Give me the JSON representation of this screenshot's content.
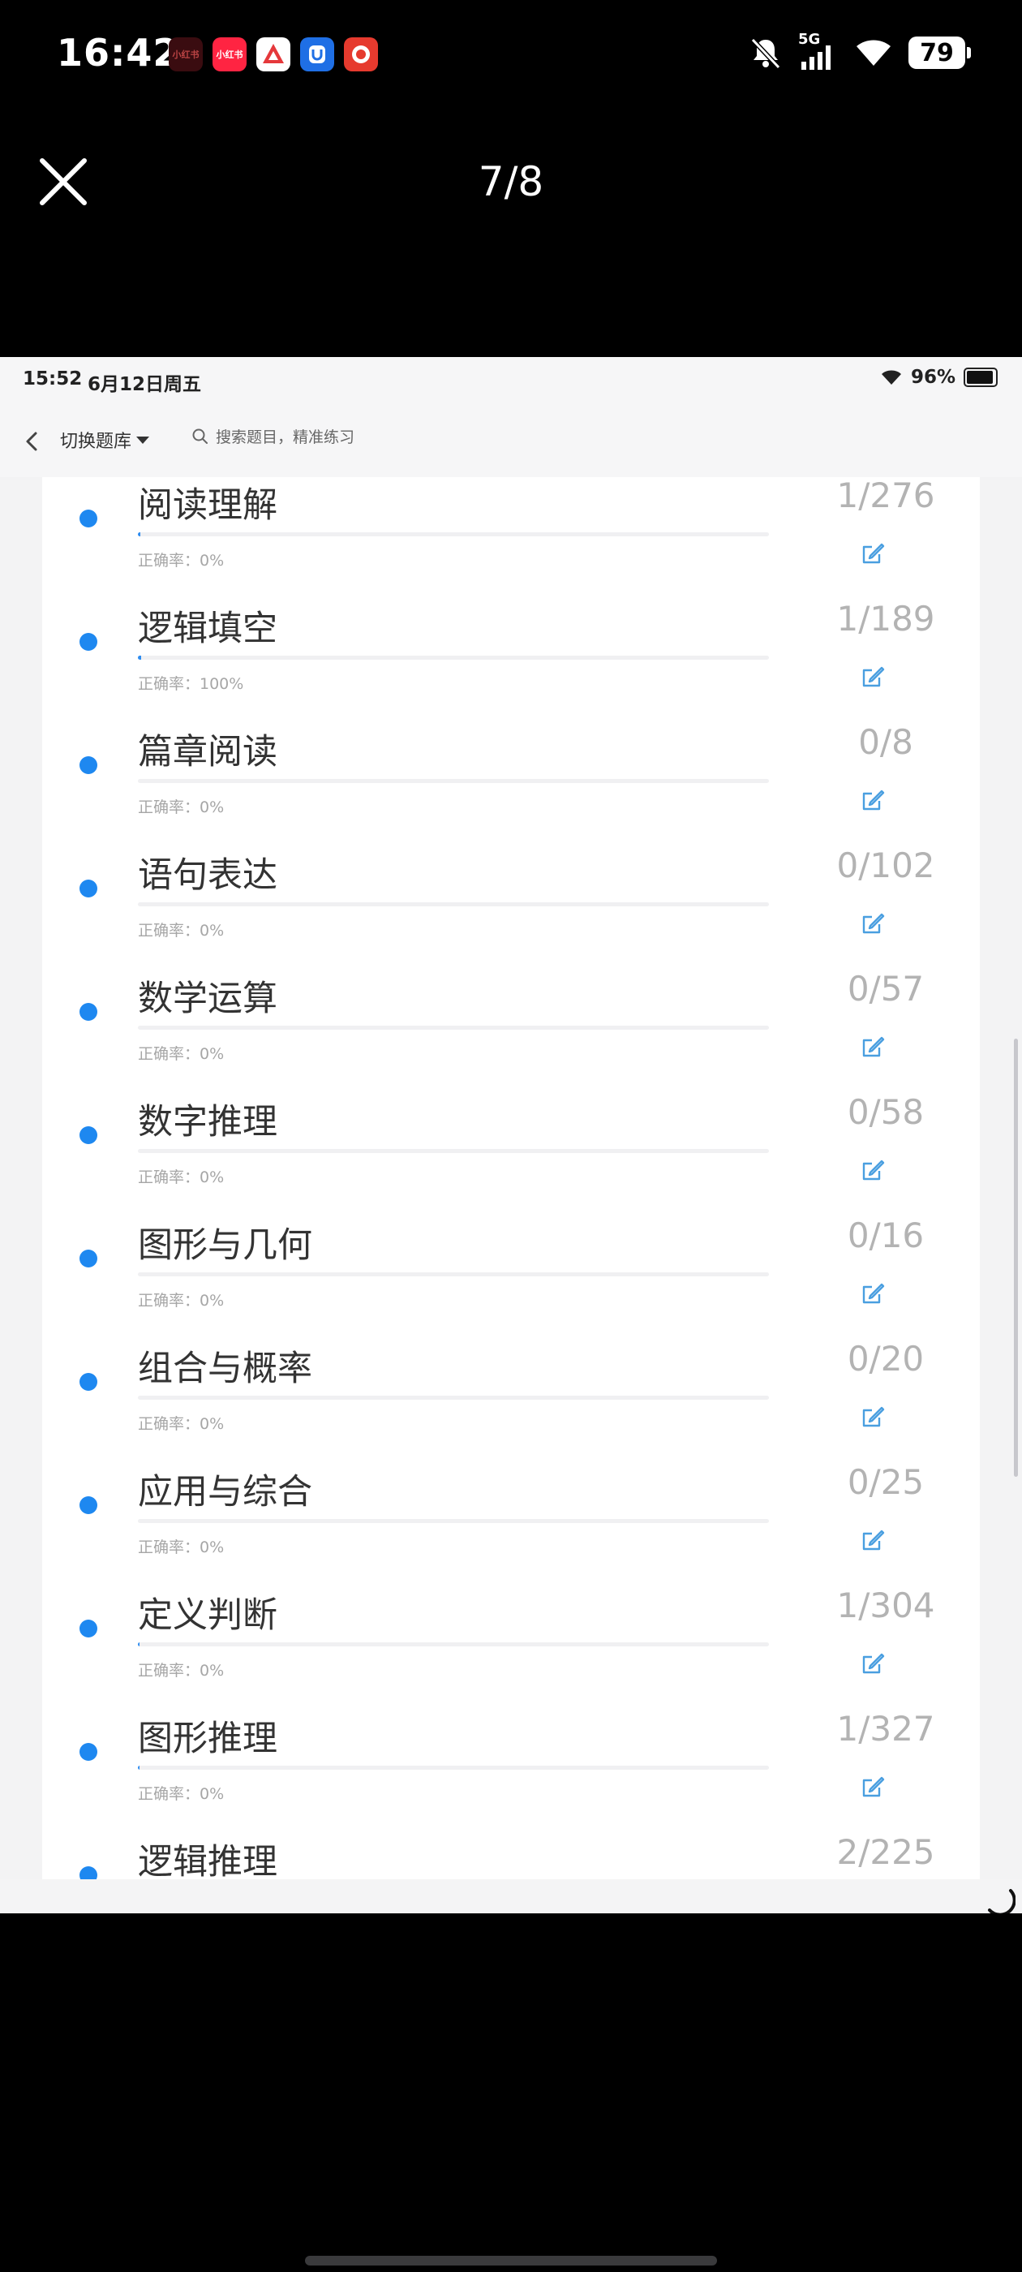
{
  "phone_status": {
    "time": "16:42",
    "battery": "79",
    "network": "5G",
    "icons": [
      "xiaohongshu-icon",
      "xiaohongshu-icon",
      "app-a-icon",
      "app-u-icon",
      "app-shop-icon",
      "mute-bell-icon",
      "signal-icon",
      "wifi-icon"
    ],
    "app_labels": [
      "小红书",
      "小红书"
    ]
  },
  "viewer": {
    "counter": "7/8"
  },
  "screenshot": {
    "status": {
      "time": "15:52",
      "date": "6月12日周五",
      "battery": "96%"
    },
    "nav": {
      "switch_label": "切换题库",
      "search_placeholder": "搜索题目，精准练习"
    },
    "rate_prefix": "正确率：",
    "items": [
      {
        "title": "阅读理解",
        "count": "1/276",
        "rate": "正确率：0%",
        "progress": 0.004
      },
      {
        "title": "逻辑填空",
        "count": "1/189",
        "rate": "正确率：100%",
        "progress": 0.005
      },
      {
        "title": "篇章阅读",
        "count": "0/8",
        "rate": "正确率：0%",
        "progress": 0
      },
      {
        "title": "语句表达",
        "count": "0/102",
        "rate": "正确率：0%",
        "progress": 0
      },
      {
        "title": "数学运算",
        "count": "0/57",
        "rate": "正确率：0%",
        "progress": 0
      },
      {
        "title": "数字推理",
        "count": "0/58",
        "rate": "正确率：0%",
        "progress": 0
      },
      {
        "title": "图形与几何",
        "count": "0/16",
        "rate": "正确率：0%",
        "progress": 0
      },
      {
        "title": "组合与概率",
        "count": "0/20",
        "rate": "正确率：0%",
        "progress": 0
      },
      {
        "title": "应用与综合",
        "count": "0/25",
        "rate": "正确率：0%",
        "progress": 0
      },
      {
        "title": "定义判断",
        "count": "1/304",
        "rate": "正确率：0%",
        "progress": 0.003
      },
      {
        "title": "图形推理",
        "count": "1/327",
        "rate": "正确率：0%",
        "progress": 0.003
      },
      {
        "title": "逻辑推理",
        "count": "2/225",
        "rate": "",
        "progress": 0.009
      }
    ]
  },
  "colors": {
    "dot": "#1e88f0",
    "progress_fill": "#2d8cf0",
    "edit_icon": "#4a9fe0"
  }
}
